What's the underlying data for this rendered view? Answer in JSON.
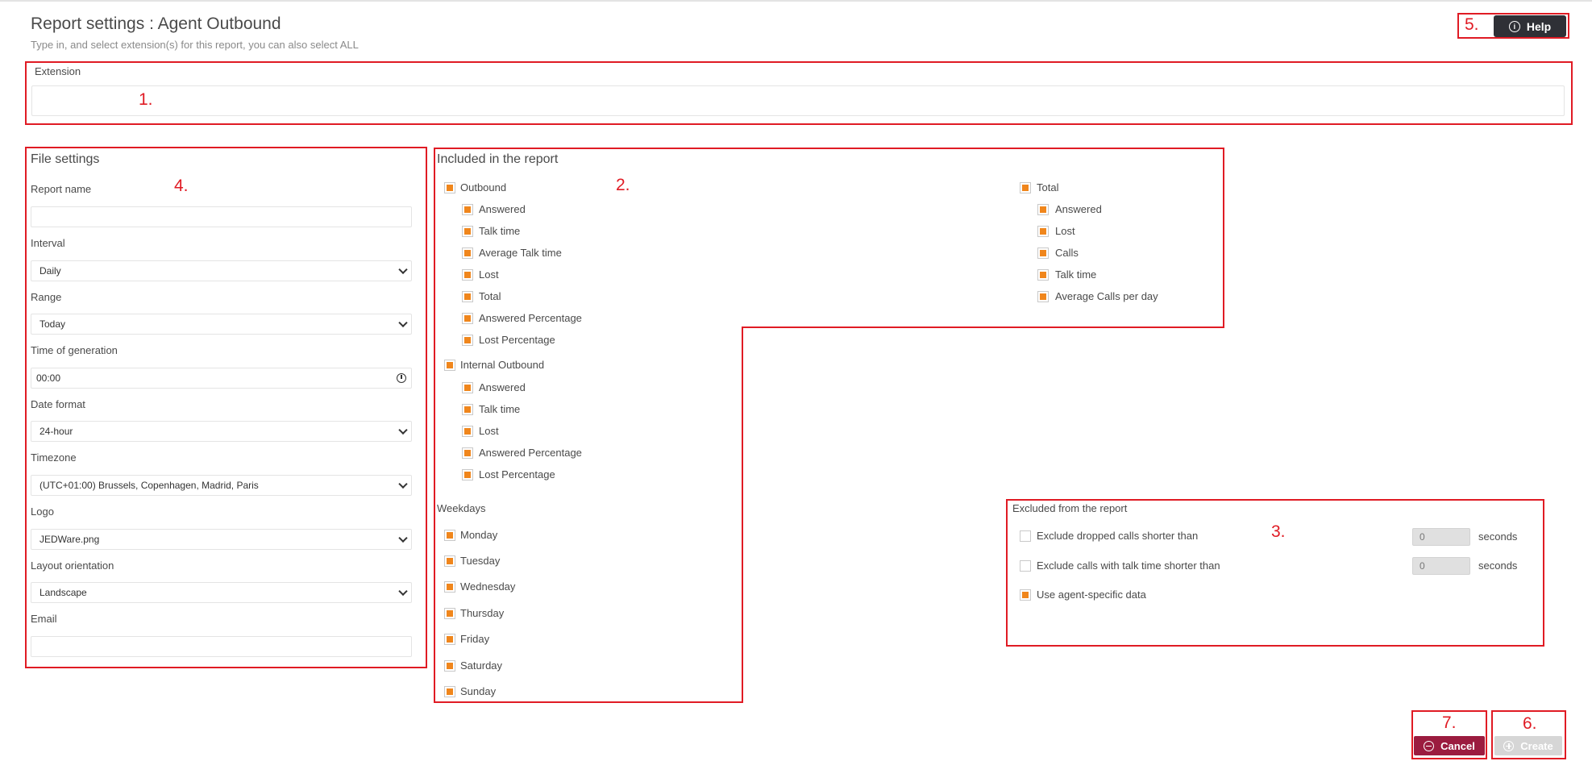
{
  "header": {
    "title": "Report settings : Agent Outbound",
    "subtitle": "Type in, and select extension(s) for this report, you can also select ALL",
    "help_label": "Help"
  },
  "markers": {
    "m1": "1.",
    "m2": "2.",
    "m3": "3.",
    "m4": "4.",
    "m5": "5.",
    "m6": "6.",
    "m7": "7."
  },
  "extension": {
    "label": "Extension",
    "value": ""
  },
  "file_settings": {
    "title": "File settings",
    "report_name_label": "Report name",
    "report_name_value": "",
    "interval_label": "Interval",
    "interval_value": "Daily",
    "range_label": "Range",
    "range_value": "Today",
    "time_label": "Time of generation",
    "time_value": "00:00",
    "date_format_label": "Date format",
    "date_format_value": "24-hour",
    "timezone_label": "Timezone",
    "timezone_value": "(UTC+01:00) Brussels, Copenhagen, Madrid, Paris",
    "logo_label": "Logo",
    "logo_value": "JEDWare.png",
    "layout_label": "Layout orientation",
    "layout_value": "Landscape",
    "email_label": "Email",
    "email_value": ""
  },
  "included": {
    "title": "Included in the report",
    "outbound": {
      "label": "Outbound",
      "checked": true,
      "items": [
        {
          "label": "Answered",
          "checked": true
        },
        {
          "label": "Talk time",
          "checked": true
        },
        {
          "label": "Average Talk time",
          "checked": true
        },
        {
          "label": "Lost",
          "checked": true
        },
        {
          "label": "Total",
          "checked": true
        },
        {
          "label": "Answered Percentage",
          "checked": true
        },
        {
          "label": "Lost Percentage",
          "checked": true
        }
      ]
    },
    "internal": {
      "label": "Internal Outbound",
      "checked": true,
      "items": [
        {
          "label": "Answered",
          "checked": true
        },
        {
          "label": "Talk time",
          "checked": true
        },
        {
          "label": "Lost",
          "checked": true
        },
        {
          "label": "Answered Percentage",
          "checked": true
        },
        {
          "label": "Lost Percentage",
          "checked": true
        }
      ]
    },
    "total": {
      "label": "Total",
      "checked": true,
      "items": [
        {
          "label": "Answered",
          "checked": true
        },
        {
          "label": "Lost",
          "checked": true
        },
        {
          "label": "Calls",
          "checked": true
        },
        {
          "label": "Talk time",
          "checked": true
        },
        {
          "label": "Average Calls per day",
          "checked": true
        }
      ]
    },
    "weekdays_title": "Weekdays",
    "weekdays": [
      {
        "label": "Monday",
        "checked": true
      },
      {
        "label": "Tuesday",
        "checked": true
      },
      {
        "label": "Wednesday",
        "checked": true
      },
      {
        "label": "Thursday",
        "checked": true
      },
      {
        "label": "Friday",
        "checked": true
      },
      {
        "label": "Saturday",
        "checked": true
      },
      {
        "label": "Sunday",
        "checked": true
      }
    ]
  },
  "excluded": {
    "title": "Excluded from the report",
    "dropped_label": "Exclude dropped calls shorter than",
    "dropped_checked": false,
    "dropped_value": "0",
    "talk_label": "Exclude calls with talk time shorter than",
    "talk_checked": false,
    "talk_value": "0",
    "unit": "seconds",
    "agent_label": "Use agent-specific data",
    "agent_checked": true
  },
  "actions": {
    "cancel_label": "Cancel",
    "create_label": "Create"
  },
  "colors": {
    "accent": "#f0861c",
    "cancel": "#9b1c3f",
    "highlight": "#e01b24",
    "help": "#2f3036"
  }
}
